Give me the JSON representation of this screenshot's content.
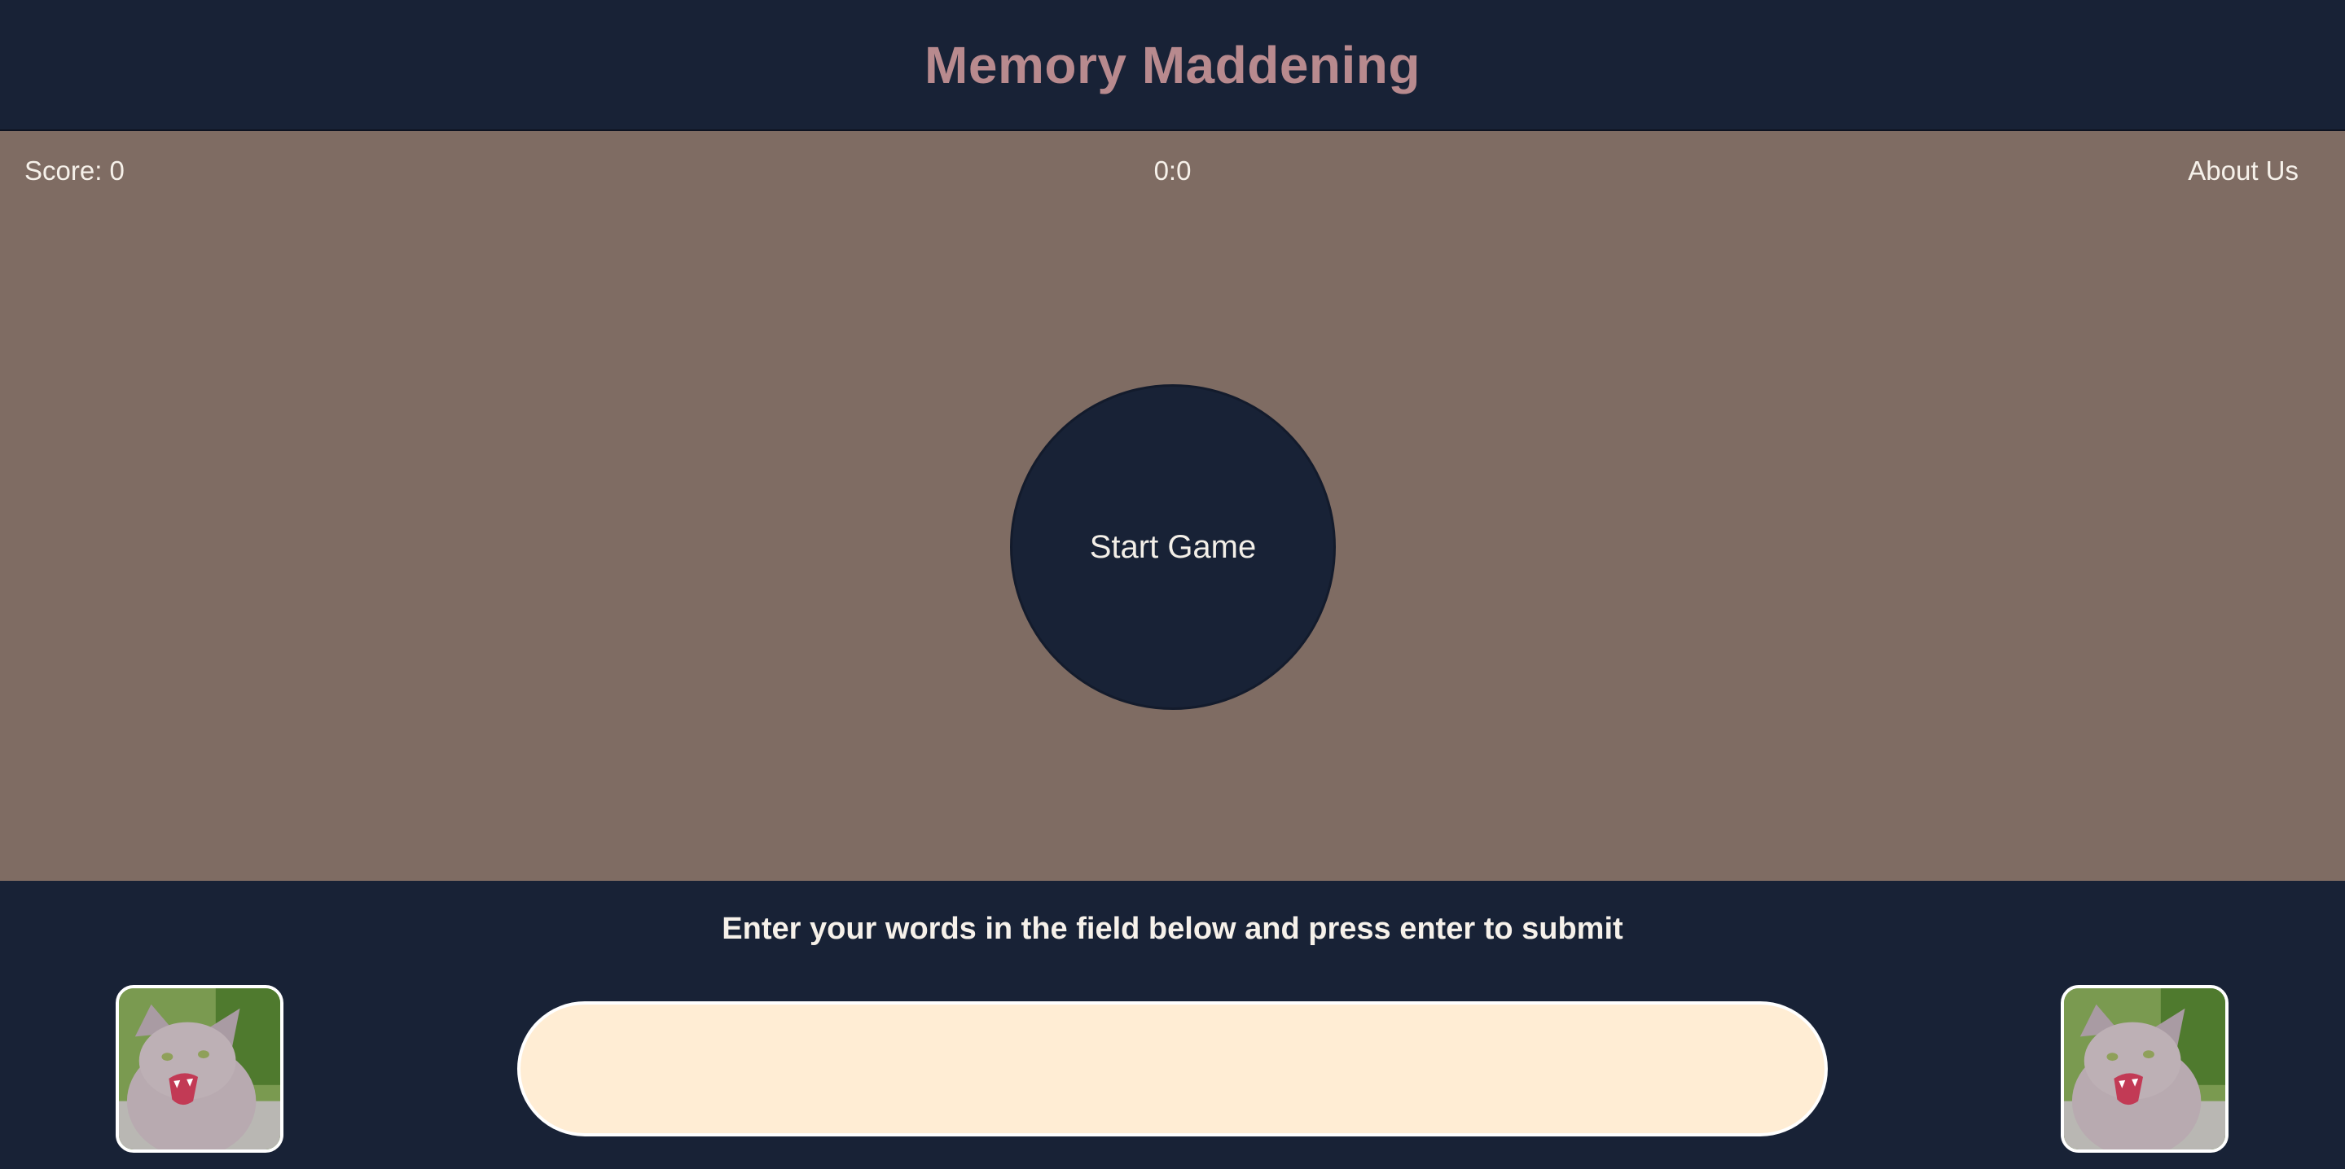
{
  "header": {
    "title": "Memory Maddening"
  },
  "status_bar": {
    "score": "Score: 0",
    "timer": "0:0",
    "about_link": "About Us"
  },
  "game": {
    "start_button": "Start Game"
  },
  "footer": {
    "instructions": "Enter your words in the field below and press enter to submit",
    "input_value": "",
    "image_left": "angry-cat-image",
    "image_right": "angry-cat-image"
  },
  "colors": {
    "header_bg": "#182236",
    "title": "#b88a8e",
    "game_bg": "#7f6c63",
    "input_bg": "#ffedd4",
    "text_light": "#f6f1ea"
  }
}
